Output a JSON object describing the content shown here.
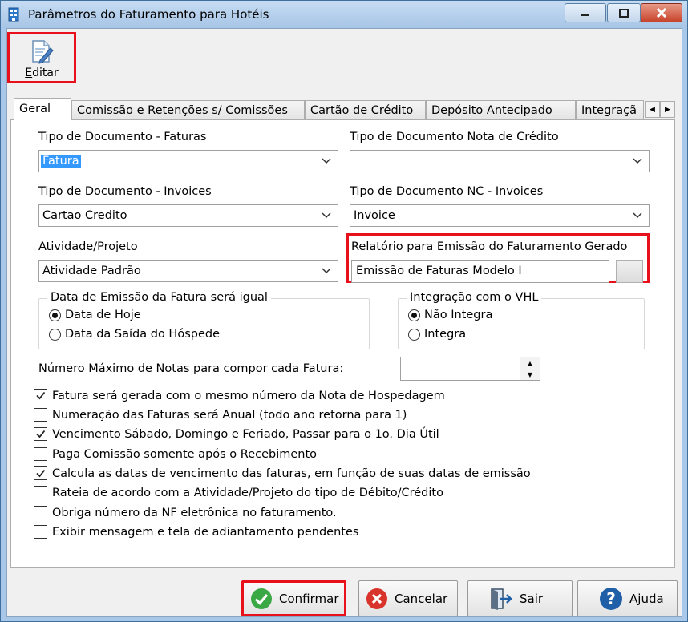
{
  "window": {
    "title": "Parâmetros do Faturamento para Hotéis"
  },
  "toolbar": {
    "edit_label_mnemonic": "E",
    "edit_label_rest": "ditar"
  },
  "tabs": [
    {
      "label": "Geral"
    },
    {
      "label": "Comissão e Retenções s/ Comissões"
    },
    {
      "label": "Cartão de Crédito"
    },
    {
      "label": "Depósito Antecipado"
    },
    {
      "label": "Integraçã"
    }
  ],
  "tab_scroll": {
    "left": "◀",
    "right": "▶"
  },
  "form": {
    "tipo_doc_faturas": {
      "label": "Tipo de Documento - Faturas",
      "value": "Fatura"
    },
    "tipo_doc_nota_credito": {
      "label": "Tipo de Documento Nota de Crédito",
      "value": ""
    },
    "tipo_doc_invoices": {
      "label": "Tipo de Documento - Invoices",
      "value": "Cartao Credito"
    },
    "tipo_doc_nc_invoices": {
      "label": "Tipo de Documento NC - Invoices",
      "value": "Invoice"
    },
    "atividade_projeto": {
      "label": "Atividade/Projeto",
      "value": "Atividade Padrão"
    },
    "relatorio": {
      "label": "Relatório para Emissão do Faturamento Gerado",
      "value": "Emissão de Faturas Modelo I"
    },
    "data_emissao_group": {
      "caption": "Data de Emissão da Fatura será igual",
      "options": [
        {
          "label": "Data de Hoje",
          "selected": true
        },
        {
          "label": "Data da Saída do Hóspede",
          "selected": false
        }
      ]
    },
    "integracao_group": {
      "caption": "Integração com o VHL",
      "options": [
        {
          "label": "Não Integra",
          "selected": true
        },
        {
          "label": "Integra",
          "selected": false
        }
      ]
    },
    "max_notas": {
      "label": "Número Máximo de Notas para compor cada Fatura:",
      "value": ""
    },
    "checkboxes": [
      {
        "label": "Fatura será gerada com o mesmo número da Nota de Hospedagem",
        "checked": true
      },
      {
        "label": "Numeração das Faturas será Anual (todo ano retorna para 1)",
        "checked": false
      },
      {
        "label": "Vencimento Sábado, Domingo e Feriado, Passar para o 1o. Dia Útil",
        "checked": true
      },
      {
        "label": "Paga Comissão somente após o Recebimento",
        "checked": false
      },
      {
        "label": "Calcula as datas de vencimento das faturas,  em função de suas datas de emissão",
        "checked": true
      },
      {
        "label": "Rateia de acordo com a Atividade/Projeto do tipo de Débito/Crédito",
        "checked": false
      },
      {
        "label": "Obriga número da NF eletrônica no faturamento.",
        "checked": false
      },
      {
        "label": "Exibir mensagem e tela de adiantamento pendentes",
        "checked": false
      }
    ]
  },
  "buttons": {
    "confirmar": {
      "mnemonic": "C",
      "rest": "onfirmar"
    },
    "cancelar": {
      "mnemonic": "C",
      "rest": "ancelar"
    },
    "sair": {
      "mnemonic": "S",
      "rest": "air"
    },
    "ajuda": {
      "pre": "Aj",
      "mnemonic": "u",
      "rest": "da"
    }
  },
  "colors": {
    "highlight": "#e8101a",
    "selection": "#3399ff",
    "confirm_green": "#3aa845",
    "cancel_red": "#d9342b",
    "help_blue": "#1f5fa8"
  }
}
